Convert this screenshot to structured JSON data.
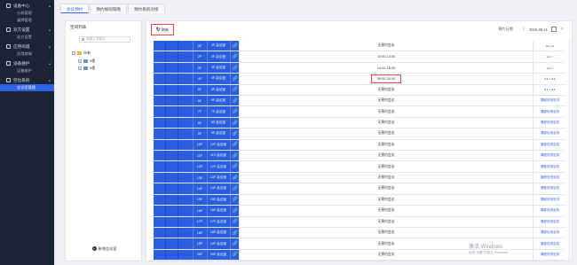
{
  "sidebar": {
    "groups": [
      {
        "label": "设备中心",
        "icon": "monitor-icon",
        "items": [
          "分机管理",
          "桌牌管理"
        ]
      },
      {
        "label": "双方设置",
        "icon": "settings-icon",
        "items": [
          "双方设置"
        ]
      },
      {
        "label": "应用商城",
        "icon": "store-icon",
        "items": [
          "应用商城"
        ]
      },
      {
        "label": "设备维护",
        "icon": "wrench-icon",
        "items": [
          "设备维护"
        ]
      },
      {
        "label": "空位系统",
        "icon": "grid-icon",
        "items": [
          "会议室管理"
        ]
      }
    ]
  },
  "tabs": [
    "会议预约",
    "预约规则策略",
    "预约系统对接"
  ],
  "left_panel": {
    "title": "空间列表",
    "search_placeholder": "请输入关键字",
    "tree": {
      "root": "所有",
      "children": [
        "3楼",
        "5楼"
      ]
    },
    "add_button": "新增会议室"
  },
  "toolbar": {
    "refresh_label": "刷新",
    "date_label": "预约日期",
    "date_value": "2025-09-11"
  },
  "rows": [
    {
      "num": "3F",
      "name": "3F-会议室",
      "status": "无预约会议",
      "action": "◂ ▸ ▪ ▸"
    },
    {
      "num": "2F",
      "name": "2F-会议室",
      "status": "10:00-13:00",
      "action": "◂ ▸ ▪"
    },
    {
      "num": "3F",
      "name": "3F-会议室",
      "status": "14:00-18:00",
      "action": "◂ ▸ ▪"
    },
    {
      "num": "4F",
      "name": "4F-会议室",
      "status": "09:00-20:30",
      "action": "◂ ▸ ▪ ◂ ▸"
    },
    {
      "num": "5F",
      "name": "5F-会议室",
      "status": "无预约会议",
      "action": "◂ ▸ ▪ ◂ ▸"
    },
    {
      "num": "6F",
      "name": "6F-会议室",
      "status": "无预约会议",
      "action": "课程安排定向"
    },
    {
      "num": "7F",
      "name": "7F-会议室",
      "status": "无预约会议",
      "action": "课程安排定向"
    },
    {
      "num": "8F",
      "name": "8F-会议室",
      "status": "无预约会议",
      "action": "课程安排定向"
    },
    {
      "num": "9F",
      "name": "9F-会议室",
      "status": "无预约会议",
      "action": "课程安排定向"
    },
    {
      "num": "10F",
      "name": "10F-会议室",
      "status": "无预约会议",
      "action": "课程安排定向"
    },
    {
      "num": "11F",
      "name": "11F-会议室",
      "status": "无预约会议",
      "action": "课程安排定向"
    },
    {
      "num": "12F",
      "name": "12F-会议室",
      "status": "无预约会议",
      "action": "课程安排定向"
    },
    {
      "num": "13F",
      "name": "13F-会议室",
      "status": "无预约会议",
      "action": "课程安排定向"
    },
    {
      "num": "14F",
      "name": "14F-会议室",
      "status": "无预约会议",
      "action": "课程安排定向"
    },
    {
      "num": "15F",
      "name": "15F-会议室",
      "status": "无预约会议",
      "action": "课程安排定向"
    },
    {
      "num": "16F",
      "name": "16F-会议室",
      "status": "无预约会议",
      "action": "课程安排定向"
    },
    {
      "num": "17F",
      "name": "17F-会议室",
      "status": "无预约会议",
      "action": "课程安排定向"
    },
    {
      "num": "18F",
      "name": "18F-会议室",
      "status": "无预约会议",
      "action": "课程安排定向"
    },
    {
      "num": "19F",
      "name": "19F-会议室",
      "status": "无预约会议",
      "action": "课程安排定向"
    },
    {
      "num": "20F",
      "name": "20F-会议室",
      "status": "无预约会议",
      "action": "课程安排定向"
    }
  ],
  "highlighted_row_index": 3,
  "watermark": {
    "line1": "激活 Windows",
    "line2": "转到\"设置\"以激活 Windows。"
  },
  "colors": {
    "accent": "#2f63e6",
    "sidebar": "#1c2538",
    "highlight": "#e04646"
  }
}
